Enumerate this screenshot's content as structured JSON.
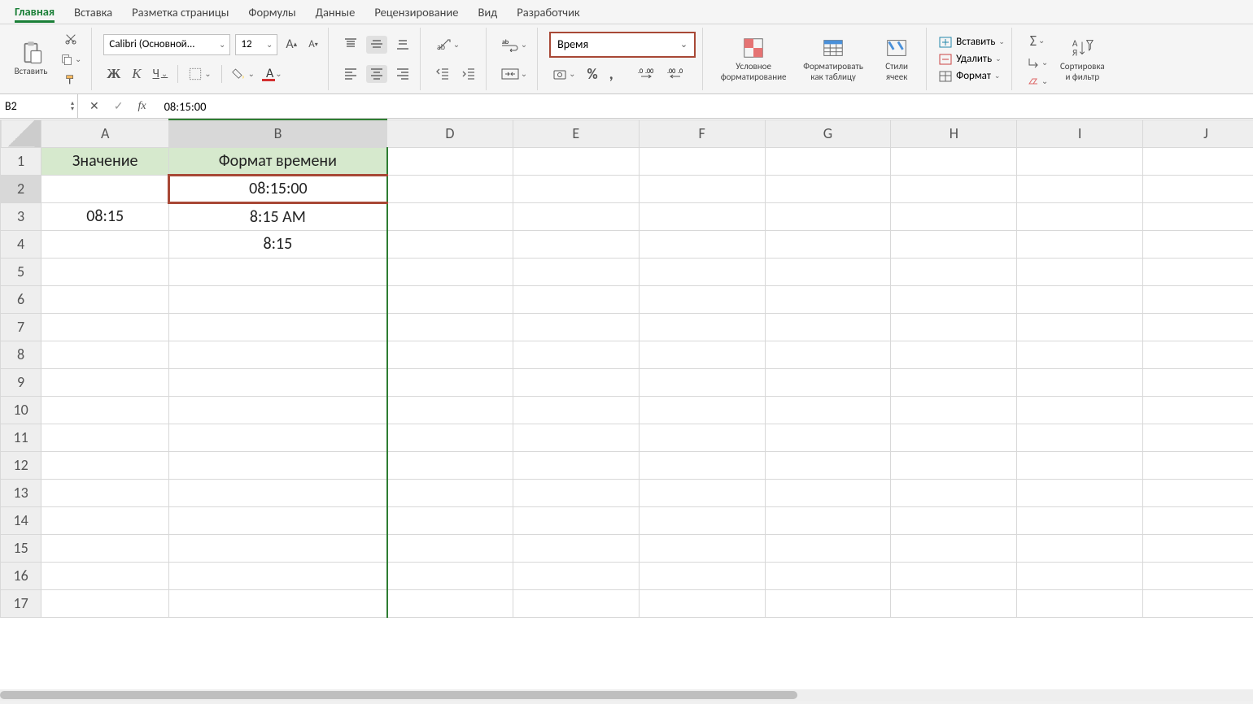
{
  "tabs": [
    "Главная",
    "Вставка",
    "Разметка страницы",
    "Формулы",
    "Данные",
    "Рецензирование",
    "Вид",
    "Разработчик"
  ],
  "active_tab_index": 0,
  "ribbon": {
    "paste_label": "Вставить",
    "font_name": "Calibri (Основной...",
    "font_size": "12",
    "bold": "Ж",
    "italic": "К",
    "underline": "Ч",
    "number_format": "Время",
    "cond_fmt": "Условное\nформатирование",
    "fmt_table": "Форматировать\nкак таблицу",
    "cell_styles": "Стили\nячеек",
    "insert": "Вставить",
    "delete": "Удалить",
    "format": "Формат",
    "sort_filter": "Сортировка\nи фильтр"
  },
  "name_box": "B2",
  "formula": "08:15:00",
  "columns": [
    "A",
    "B",
    "D",
    "E",
    "F",
    "G",
    "H",
    "I",
    "J"
  ],
  "rows_count": 17,
  "cells": {
    "A1": "Значение",
    "B1": "Формат времени",
    "A3": "08:15",
    "B2": "08:15:00",
    "B3": "8:15 AM",
    "B4": "8:15"
  },
  "selected_cell": "B2",
  "selected_col": "B",
  "selected_row": "2"
}
